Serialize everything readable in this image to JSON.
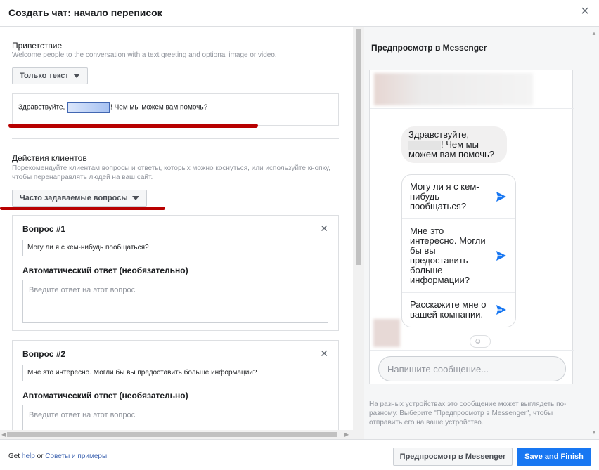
{
  "dialog": {
    "title": "Создать чат: начало переписок",
    "close_symbol": "×"
  },
  "greeting": {
    "title": "Приветствие",
    "subtitle": "Welcome people to the conversation with a text greeting and optional image or video.",
    "mode_dropdown": "Только текст",
    "text_before": "Здравствуйте,",
    "text_after": "! Чем мы можем вам помочь?"
  },
  "customer_actions": {
    "title": "Действия клиентов",
    "subtitle": "Порекомендуйте клиентам вопросы и ответы, которых можно коснуться, или используйте кнопку, чтобы перенаправлять людей на ваш сайт.",
    "type_dropdown": "Часто задаваемые вопросы"
  },
  "questions": [
    {
      "title": "Вопрос #1",
      "value": "Могу ли я с кем-нибудь пообщаться?",
      "answer_label": "Автоматический ответ (необязательно)",
      "answer_placeholder": "Введите ответ на этот вопрос"
    },
    {
      "title": "Вопрос #2",
      "value": "Мне это интересно. Могли бы вы предоставить больше информации?",
      "answer_label": "Автоматический ответ (необязательно)",
      "answer_placeholder": "Введите ответ на этот вопрос"
    }
  ],
  "preview": {
    "title": "Предпросмотр в Messenger",
    "greeting_before": "Здравствуйте,",
    "greeting_after": "! Чем мы можем вам помочь?",
    "quick_replies": [
      "Могу ли я с кем-нибудь пообщаться?",
      "Мне это интересно. Могли бы вы предоставить больше информации?",
      "Расскажите мне о вашей компании."
    ],
    "composer_placeholder": "Напишите сообщение...",
    "disclaimer": "На разных устройствах это сообщение может выглядеть по-разному. Выберите \"Предпросмотр в Messenger\", чтобы отправить его на ваше устройство."
  },
  "footer": {
    "prefix": "Get",
    "help_link": "help",
    "conjunction": "or",
    "tips_link": "Советы и примеры.",
    "preview_button": "Предпросмотр в Messenger",
    "save_button": "Save and Finish"
  },
  "colors": {
    "accent": "#1877f2",
    "annotation_red": "#b80000",
    "link": "#4267b2"
  },
  "icons": [
    "close-icon",
    "caret-down-icon",
    "remove-question-icon",
    "send-icon",
    "reaction-icon"
  ]
}
